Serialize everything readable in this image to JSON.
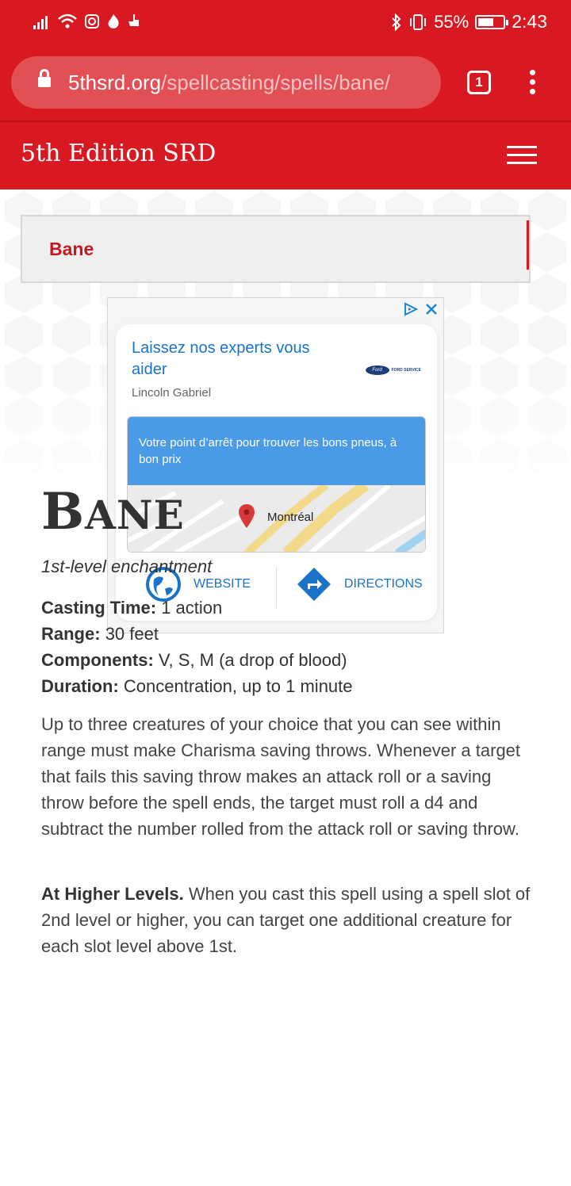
{
  "status_bar": {
    "battery_percent": "55%",
    "time": "2:43"
  },
  "browser": {
    "url_domain": "5thsrd.org",
    "url_path": "/spellcasting/spells/bane/",
    "tab_count": "1"
  },
  "site": {
    "title": "5th Edition SRD"
  },
  "breadcrumb": {
    "current": "Bane"
  },
  "ad": {
    "headline": "Laissez nos experts vous aider",
    "advertiser": "Lincoln Gabriel",
    "brand_logo": "Ford",
    "brand_text": "FORD SERVICE",
    "banner_text": "Votre point d’arrêt pour trouver les bons pneus, à bon prix",
    "map_label": "Montréal",
    "website_label": "WEBSITE",
    "directions_label": "DIRECTIONS"
  },
  "spell": {
    "title_initial": "B",
    "title_rest": "ANE",
    "level": "1st-level enchantment",
    "casting_time_label": "Casting Time:",
    "casting_time": "1 action",
    "range_label": "Range:",
    "range": "30 feet",
    "components_label": "Components:",
    "components": "V, S, M (a drop of blood)",
    "duration_label": "Duration:",
    "duration": "Concentration, up to 1 minute",
    "description": "Up to three creatures of your choice that you can see within range must make Charisma saving throws. Whenever a target that fails this saving throw makes an attack roll or a saving throw before the spell ends, the target must roll a d4 and subtract the number rolled from the attack roll or saving throw.",
    "higher_levels_label": "At Higher Levels.",
    "higher_levels": "When you cast this spell using a spell slot of 2nd level or higher, you can target one additional creature for each slot level above 1st."
  },
  "colors": {
    "brand_red": "#d81921",
    "link_blue": "#1a73c9",
    "banner_blue": "#4a9ae8"
  }
}
